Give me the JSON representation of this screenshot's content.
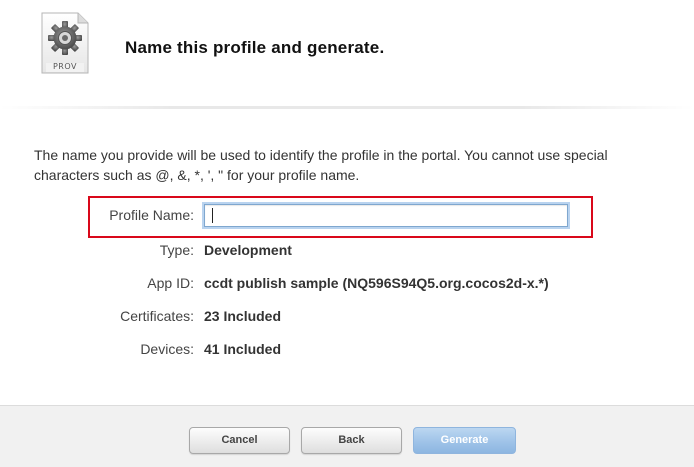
{
  "header": {
    "icon_name": "provisioning-profile-gear-icon",
    "icon_caption": "PROV",
    "title": "Name this profile and generate."
  },
  "intro": "The name you provide will be used to identify the profile in the portal. You cannot use special characters such as @, &, *, ', \" for your profile name.",
  "form": {
    "profile_name_label": "Profile Name:",
    "profile_name_value": "",
    "type_label": "Type:",
    "type_value": "Development",
    "app_id_label": "App ID:",
    "app_id_value": "ccdt publish sample (NQ596S94Q5.org.cocos2d-x.*)",
    "certificates_label": "Certificates:",
    "certificates_value": "23 Included",
    "devices_label": "Devices:",
    "devices_value": "41 Included"
  },
  "buttons": {
    "cancel_label": "Cancel",
    "back_label": "Back",
    "generate_label": "Generate"
  },
  "colors": {
    "highlight": "#d9081a",
    "primary_button": "#9fc3e8"
  }
}
